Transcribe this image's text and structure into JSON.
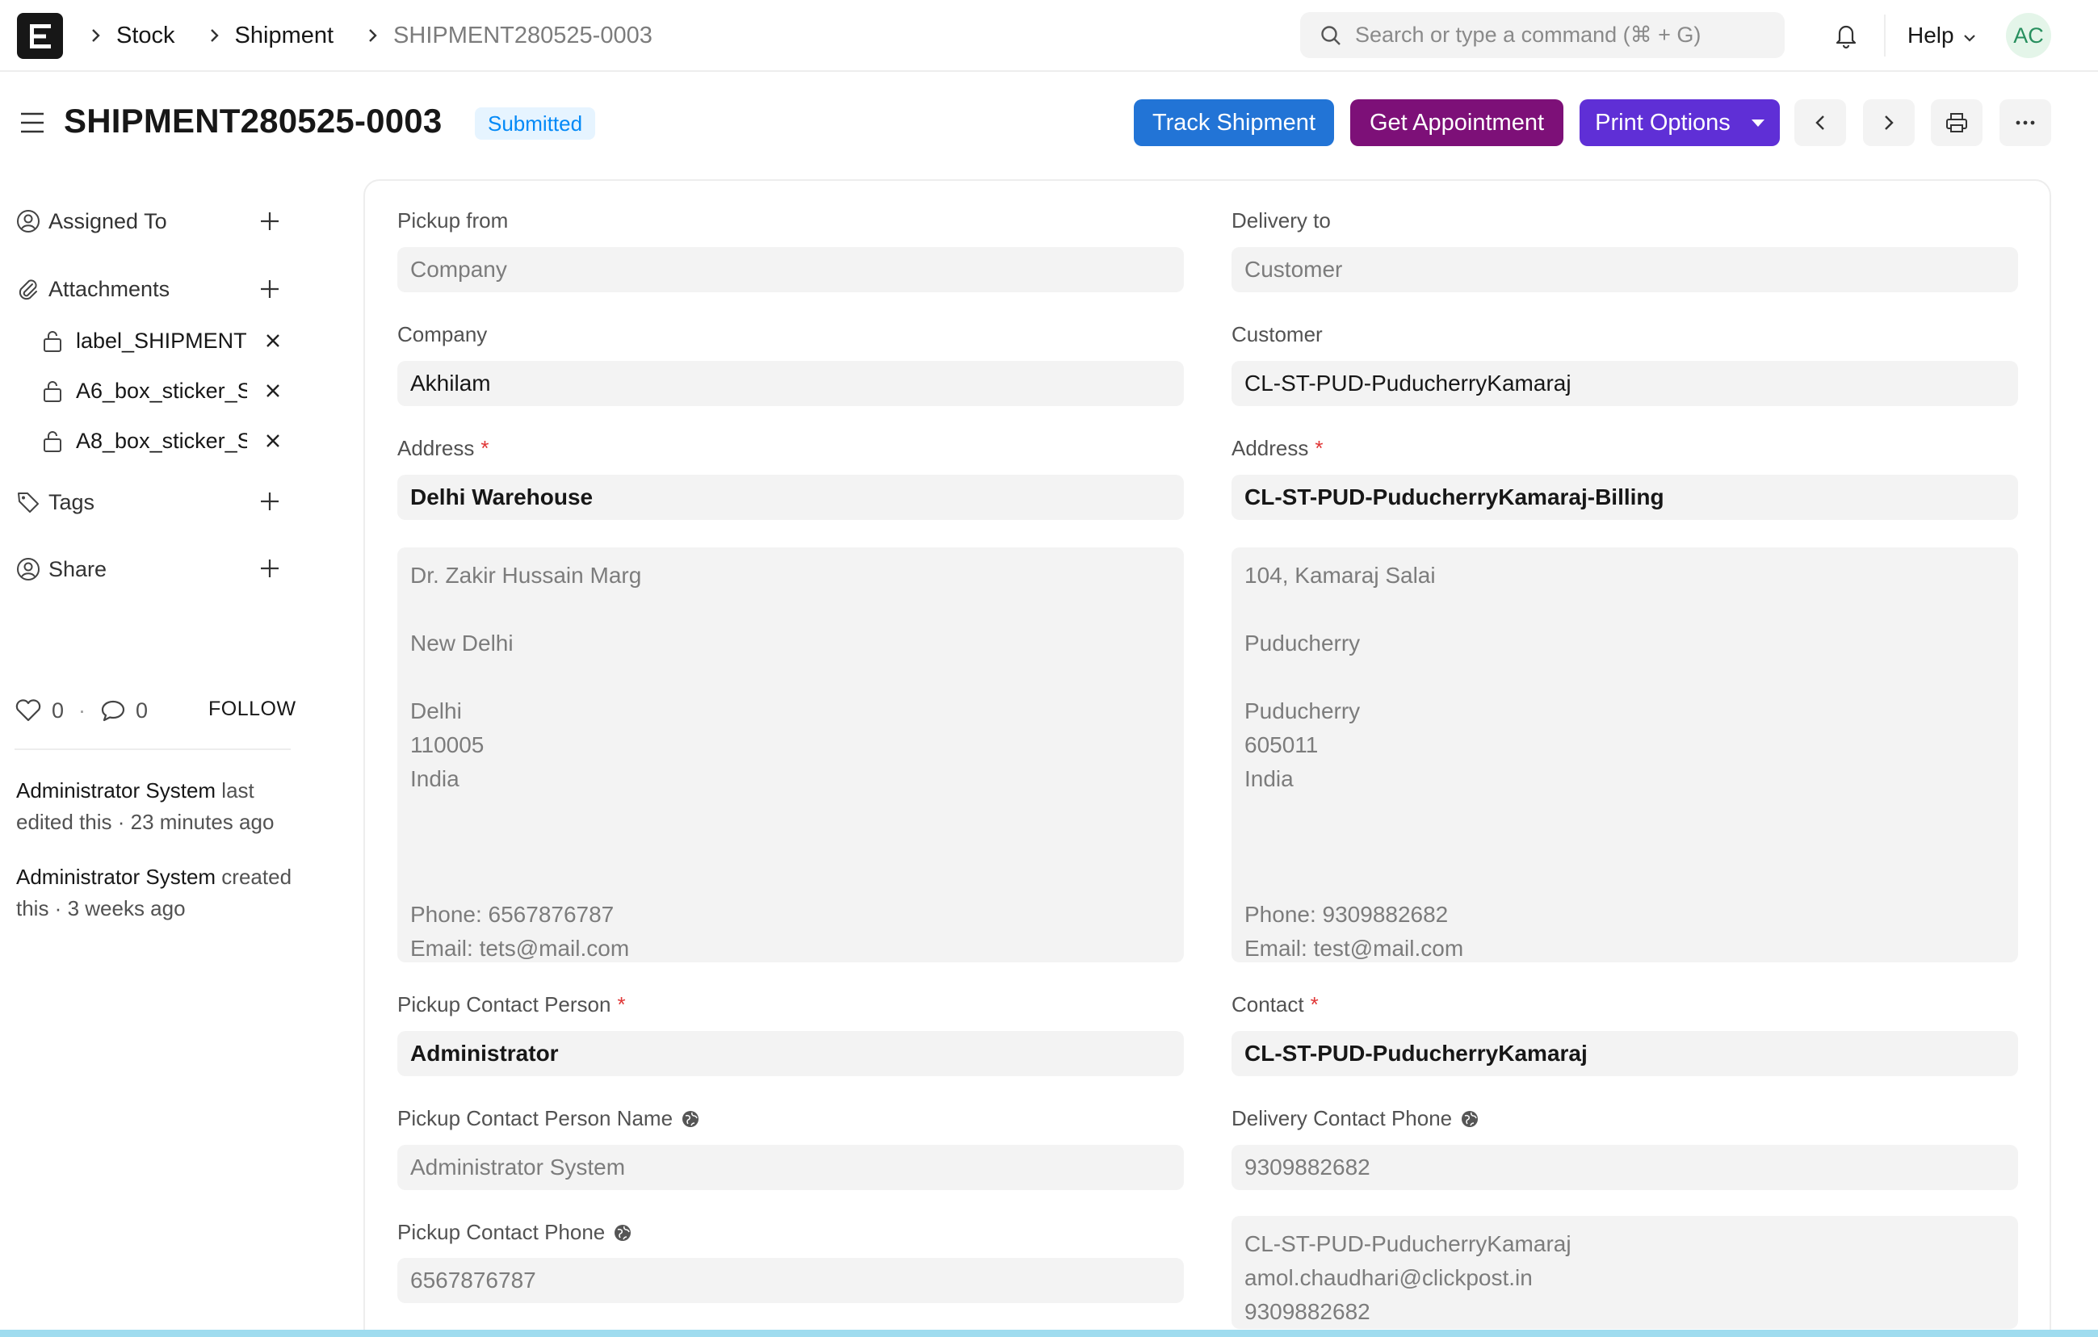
{
  "navbar": {
    "logo_letter": "E",
    "breadcrumbs": [
      "Stock",
      "Shipment",
      "SHIPMENT280525-0003"
    ],
    "search_placeholder": "Search or type a command (⌘ + G)",
    "help_label": "Help",
    "avatar_initials": "AC"
  },
  "header": {
    "title": "SHIPMENT280525-0003",
    "status": "Submitted",
    "buttons": {
      "track": "Track Shipment",
      "appointment": "Get Appointment",
      "print_options": "Print Options"
    }
  },
  "sidebar": {
    "assigned_to": "Assigned To",
    "attachments": "Attachments",
    "attachment_files": [
      "label_SHIPMENT",
      "A6_box_sticker_S",
      "A8_box_sticker_S"
    ],
    "tags": "Tags",
    "share": "Share",
    "likes": "0",
    "comments": "0",
    "follow": "FOLLOW",
    "activity": [
      {
        "who": "Administrator System",
        "text": " last edited this · 23 minutes ago"
      },
      {
        "who": "Administrator System",
        "text": " created this · 3 weeks ago"
      }
    ]
  },
  "form": {
    "pickup_from_label": "Pickup from",
    "pickup_from_value": "Company",
    "delivery_to_label": "Delivery to",
    "delivery_to_value": "Customer",
    "company_label": "Company",
    "company_value": "Akhilam",
    "customer_label": "Customer",
    "customer_value": "CL-ST-PUD-PuducherryKamaraj",
    "pickup_address_label": "Address",
    "pickup_address_value": "Delhi Warehouse",
    "delivery_address_label": "Address",
    "delivery_address_value": "CL-ST-PUD-PuducherryKamaraj-Billing",
    "pickup_address_display": "Dr. Zakir Hussain Marg\n\nNew Delhi\n\nDelhi\n110005\nIndia\n\n\n\nPhone: 6567876787\nEmail: tets@mail.com",
    "delivery_address_display": "104, Kamaraj Salai\n\nPuducherry\n\nPuducherry\n605011\nIndia\n\n\n\nPhone: 9309882682\nEmail: test@mail.com",
    "pickup_contact_person_label": "Pickup Contact Person",
    "pickup_contact_person_value": "Administrator",
    "contact_label": "Contact",
    "contact_value": "CL-ST-PUD-PuducherryKamaraj",
    "pickup_contact_person_name_label": "Pickup Contact Person Name",
    "pickup_contact_person_name_value": "Administrator System",
    "delivery_contact_phone_label": "Delivery Contact Phone",
    "delivery_contact_phone_value": "9309882682",
    "pickup_contact_phone_label": "Pickup Contact Phone",
    "pickup_contact_phone_value": "6567876787",
    "delivery_contact_display": "CL-ST-PUD-PuducherryKamaraj\namol.chaudhari@clickpost.in\n9309882682"
  }
}
